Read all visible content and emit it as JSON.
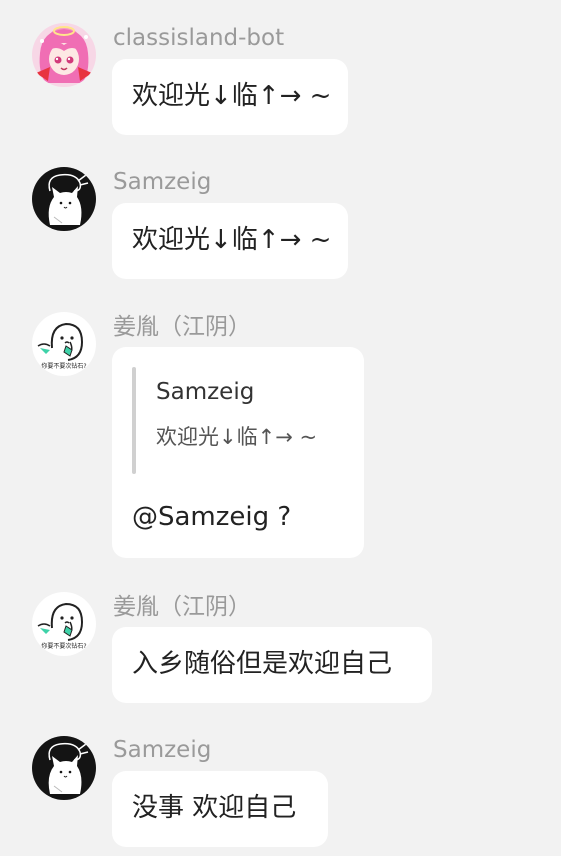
{
  "messages": [
    {
      "sender": "classisland-bot",
      "avatar": "anime-girl-avatar",
      "text": "欢迎光↓临↑→ ~"
    },
    {
      "sender": "Samzeig",
      "avatar": "white-cat-avatar",
      "text": "欢迎光↓临↑→ ~"
    },
    {
      "sender": "姜胤（江阴）",
      "avatar": "meme-sticker-avatar",
      "avatar_caption": "你要不要次钻石?",
      "quote": {
        "name": "Samzeig",
        "text": "欢迎光↓临↑→ ~"
      },
      "text": "@Samzeig ?"
    },
    {
      "sender": "姜胤（江阴）",
      "avatar": "meme-sticker-avatar",
      "avatar_caption": "你要不要次钻石?",
      "text": "入乡随俗但是欢迎自己"
    },
    {
      "sender": "Samzeig",
      "avatar": "white-cat-avatar",
      "text": "没事 欢迎自己"
    }
  ],
  "colors": {
    "background": "#f2f2f2",
    "bubble": "#ffffff",
    "sender_name": "#9a9a9a",
    "message_text": "#222222",
    "quote_bar": "#d0d0d0"
  }
}
